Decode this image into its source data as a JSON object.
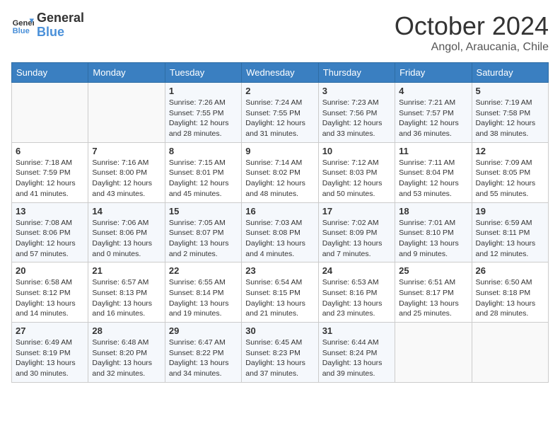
{
  "header": {
    "logo_line1": "General",
    "logo_line2": "Blue",
    "month": "October 2024",
    "location": "Angol, Araucania, Chile"
  },
  "weekdays": [
    "Sunday",
    "Monday",
    "Tuesday",
    "Wednesday",
    "Thursday",
    "Friday",
    "Saturday"
  ],
  "weeks": [
    [
      {
        "day": "",
        "sunrise": "",
        "sunset": "",
        "daylight": ""
      },
      {
        "day": "",
        "sunrise": "",
        "sunset": "",
        "daylight": ""
      },
      {
        "day": "1",
        "sunrise": "Sunrise: 7:26 AM",
        "sunset": "Sunset: 7:55 PM",
        "daylight": "Daylight: 12 hours and 28 minutes."
      },
      {
        "day": "2",
        "sunrise": "Sunrise: 7:24 AM",
        "sunset": "Sunset: 7:55 PM",
        "daylight": "Daylight: 12 hours and 31 minutes."
      },
      {
        "day": "3",
        "sunrise": "Sunrise: 7:23 AM",
        "sunset": "Sunset: 7:56 PM",
        "daylight": "Daylight: 12 hours and 33 minutes."
      },
      {
        "day": "4",
        "sunrise": "Sunrise: 7:21 AM",
        "sunset": "Sunset: 7:57 PM",
        "daylight": "Daylight: 12 hours and 36 minutes."
      },
      {
        "day": "5",
        "sunrise": "Sunrise: 7:19 AM",
        "sunset": "Sunset: 7:58 PM",
        "daylight": "Daylight: 12 hours and 38 minutes."
      }
    ],
    [
      {
        "day": "6",
        "sunrise": "Sunrise: 7:18 AM",
        "sunset": "Sunset: 7:59 PM",
        "daylight": "Daylight: 12 hours and 41 minutes."
      },
      {
        "day": "7",
        "sunrise": "Sunrise: 7:16 AM",
        "sunset": "Sunset: 8:00 PM",
        "daylight": "Daylight: 12 hours and 43 minutes."
      },
      {
        "day": "8",
        "sunrise": "Sunrise: 7:15 AM",
        "sunset": "Sunset: 8:01 PM",
        "daylight": "Daylight: 12 hours and 45 minutes."
      },
      {
        "day": "9",
        "sunrise": "Sunrise: 7:14 AM",
        "sunset": "Sunset: 8:02 PM",
        "daylight": "Daylight: 12 hours and 48 minutes."
      },
      {
        "day": "10",
        "sunrise": "Sunrise: 7:12 AM",
        "sunset": "Sunset: 8:03 PM",
        "daylight": "Daylight: 12 hours and 50 minutes."
      },
      {
        "day": "11",
        "sunrise": "Sunrise: 7:11 AM",
        "sunset": "Sunset: 8:04 PM",
        "daylight": "Daylight: 12 hours and 53 minutes."
      },
      {
        "day": "12",
        "sunrise": "Sunrise: 7:09 AM",
        "sunset": "Sunset: 8:05 PM",
        "daylight": "Daylight: 12 hours and 55 minutes."
      }
    ],
    [
      {
        "day": "13",
        "sunrise": "Sunrise: 7:08 AM",
        "sunset": "Sunset: 8:06 PM",
        "daylight": "Daylight: 12 hours and 57 minutes."
      },
      {
        "day": "14",
        "sunrise": "Sunrise: 7:06 AM",
        "sunset": "Sunset: 8:06 PM",
        "daylight": "Daylight: 13 hours and 0 minutes."
      },
      {
        "day": "15",
        "sunrise": "Sunrise: 7:05 AM",
        "sunset": "Sunset: 8:07 PM",
        "daylight": "Daylight: 13 hours and 2 minutes."
      },
      {
        "day": "16",
        "sunrise": "Sunrise: 7:03 AM",
        "sunset": "Sunset: 8:08 PM",
        "daylight": "Daylight: 13 hours and 4 minutes."
      },
      {
        "day": "17",
        "sunrise": "Sunrise: 7:02 AM",
        "sunset": "Sunset: 8:09 PM",
        "daylight": "Daylight: 13 hours and 7 minutes."
      },
      {
        "day": "18",
        "sunrise": "Sunrise: 7:01 AM",
        "sunset": "Sunset: 8:10 PM",
        "daylight": "Daylight: 13 hours and 9 minutes."
      },
      {
        "day": "19",
        "sunrise": "Sunrise: 6:59 AM",
        "sunset": "Sunset: 8:11 PM",
        "daylight": "Daylight: 13 hours and 12 minutes."
      }
    ],
    [
      {
        "day": "20",
        "sunrise": "Sunrise: 6:58 AM",
        "sunset": "Sunset: 8:12 PM",
        "daylight": "Daylight: 13 hours and 14 minutes."
      },
      {
        "day": "21",
        "sunrise": "Sunrise: 6:57 AM",
        "sunset": "Sunset: 8:13 PM",
        "daylight": "Daylight: 13 hours and 16 minutes."
      },
      {
        "day": "22",
        "sunrise": "Sunrise: 6:55 AM",
        "sunset": "Sunset: 8:14 PM",
        "daylight": "Daylight: 13 hours and 19 minutes."
      },
      {
        "day": "23",
        "sunrise": "Sunrise: 6:54 AM",
        "sunset": "Sunset: 8:15 PM",
        "daylight": "Daylight: 13 hours and 21 minutes."
      },
      {
        "day": "24",
        "sunrise": "Sunrise: 6:53 AM",
        "sunset": "Sunset: 8:16 PM",
        "daylight": "Daylight: 13 hours and 23 minutes."
      },
      {
        "day": "25",
        "sunrise": "Sunrise: 6:51 AM",
        "sunset": "Sunset: 8:17 PM",
        "daylight": "Daylight: 13 hours and 25 minutes."
      },
      {
        "day": "26",
        "sunrise": "Sunrise: 6:50 AM",
        "sunset": "Sunset: 8:18 PM",
        "daylight": "Daylight: 13 hours and 28 minutes."
      }
    ],
    [
      {
        "day": "27",
        "sunrise": "Sunrise: 6:49 AM",
        "sunset": "Sunset: 8:19 PM",
        "daylight": "Daylight: 13 hours and 30 minutes."
      },
      {
        "day": "28",
        "sunrise": "Sunrise: 6:48 AM",
        "sunset": "Sunset: 8:20 PM",
        "daylight": "Daylight: 13 hours and 32 minutes."
      },
      {
        "day": "29",
        "sunrise": "Sunrise: 6:47 AM",
        "sunset": "Sunset: 8:22 PM",
        "daylight": "Daylight: 13 hours and 34 minutes."
      },
      {
        "day": "30",
        "sunrise": "Sunrise: 6:45 AM",
        "sunset": "Sunset: 8:23 PM",
        "daylight": "Daylight: 13 hours and 37 minutes."
      },
      {
        "day": "31",
        "sunrise": "Sunrise: 6:44 AM",
        "sunset": "Sunset: 8:24 PM",
        "daylight": "Daylight: 13 hours and 39 minutes."
      },
      {
        "day": "",
        "sunrise": "",
        "sunset": "",
        "daylight": ""
      },
      {
        "day": "",
        "sunrise": "",
        "sunset": "",
        "daylight": ""
      }
    ]
  ]
}
